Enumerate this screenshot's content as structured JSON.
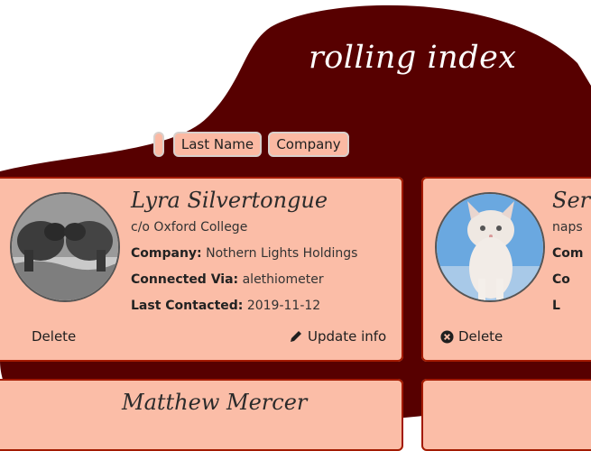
{
  "app": {
    "title": "rolling index"
  },
  "sort_buttons": [
    {
      "label": "Last Name"
    },
    {
      "label": "Company"
    }
  ],
  "contacts": [
    {
      "name": "Lyra Silvertongue",
      "address": "c/o Oxford College",
      "company_label": "Company:",
      "company": "Nothern Lights Holdings",
      "connected_label": "Connected Via:",
      "connected": "alethiometer",
      "last_label": "Last Contacted:",
      "last": "2019-11-12",
      "delete_label": "Delete",
      "update_label": "Update info"
    },
    {
      "name": "Ser",
      "address": "naps",
      "company_label": "Com",
      "connected_label": "Co",
      "last_label": "L",
      "delete_label": "Delete"
    },
    {
      "name": "Matthew Mercer"
    }
  ],
  "icons": {
    "delete": "x-circle-icon",
    "update": "pencil-icon"
  },
  "colors": {
    "background": "#570000",
    "card": "#fbbda7",
    "button": "#fbb9a3",
    "accent": "#a31a00"
  }
}
